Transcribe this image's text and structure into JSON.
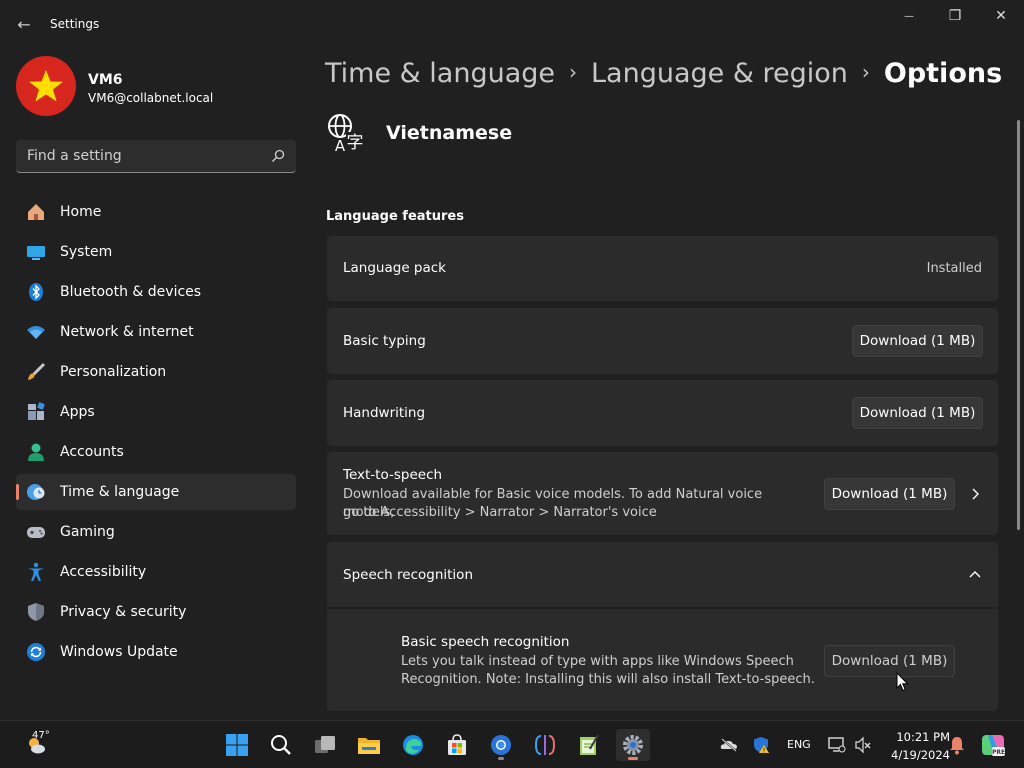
{
  "window": {
    "title": "Settings",
    "back_glyph": "←",
    "minimize_glyph": "—",
    "maximize_glyph": "❐",
    "close_glyph": "✕"
  },
  "user": {
    "name": "VM6",
    "email": "VM6@collabnet.local",
    "avatar_colors": {
      "background": "#d7261e",
      "star": "#ffde00"
    }
  },
  "search": {
    "placeholder": "Find a setting"
  },
  "nav": [
    {
      "label": "Home",
      "icon": "home-icon",
      "active": false
    },
    {
      "label": "System",
      "icon": "system-icon",
      "active": false
    },
    {
      "label": "Bluetooth & devices",
      "icon": "bluetooth-icon",
      "active": false
    },
    {
      "label": "Network & internet",
      "icon": "network-icon",
      "active": false
    },
    {
      "label": "Personalization",
      "icon": "brush-icon",
      "active": false
    },
    {
      "label": "Apps",
      "icon": "apps-icon",
      "active": false
    },
    {
      "label": "Accounts",
      "icon": "accounts-icon",
      "active": false
    },
    {
      "label": "Time & language",
      "icon": "time-language-icon",
      "active": true
    },
    {
      "label": "Gaming",
      "icon": "gaming-icon",
      "active": false
    },
    {
      "label": "Accessibility",
      "icon": "accessibility-icon",
      "active": false
    },
    {
      "label": "Privacy & security",
      "icon": "shield-icon",
      "active": false
    },
    {
      "label": "Windows Update",
      "icon": "update-icon",
      "active": false
    }
  ],
  "breadcrumb": {
    "level1": "Time & language",
    "level2": "Language & region",
    "current": "Options",
    "separator": "›"
  },
  "language": {
    "name": "Vietnamese",
    "icon": "language-icon"
  },
  "section": {
    "title": "Language features"
  },
  "features": {
    "language_pack": {
      "title": "Language pack",
      "status": "Installed"
    },
    "basic_typing": {
      "title": "Basic typing",
      "button": "Download (1 MB)"
    },
    "handwriting": {
      "title": "Handwriting",
      "button": "Download (1 MB)"
    },
    "tts": {
      "title": "Text-to-speech",
      "desc_line1": "Download available for Basic voice models. To add Natural voice models,",
      "desc_line2": "go to Accessibility > Narrator > Narrator's voice",
      "button": "Download (1 MB)"
    },
    "speech": {
      "title": "Speech recognition",
      "expanded": true
    },
    "basic_speech": {
      "title": "Basic speech recognition",
      "desc_line1": "Lets you talk instead of type with apps like Windows Speech",
      "desc_line2": "Recognition. Note: Installing this will also install Text-to-speech.",
      "button": "Download (1 MB)"
    }
  },
  "taskbar": {
    "weather_temp": "47°",
    "apps": [
      "start-icon",
      "search-icon",
      "task-view-icon",
      "file-explorer-icon",
      "edge-icon",
      "store-icon",
      "chrome-icon",
      "vscode-icon",
      "notepad-icon",
      "settings-icon"
    ],
    "tray": {
      "language": "ENG",
      "time": "10:21 PM",
      "date": "4/19/2024"
    }
  },
  "colors": {
    "accent": "#e8836a",
    "background": "#202020",
    "card": "#2b2b2b"
  }
}
